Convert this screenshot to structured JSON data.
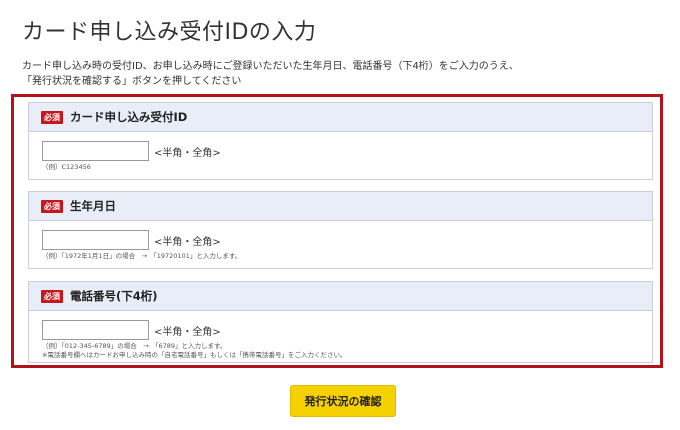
{
  "page": {
    "title": "カード申し込み受付IDの入力",
    "intro_line1": "カード申し込み時の受付ID、お申し込み時にご登録いただいた生年月日、電話番号（下4桁）をご入力のうえ、",
    "intro_line2": "「発行状況を確認する」ボタンを押してください"
  },
  "form": {
    "required_badge": "必須",
    "fields": [
      {
        "label": "カード申し込み受付ID",
        "value": "",
        "hint": "<半角・全角>",
        "notes": [
          "（例）C123456"
        ]
      },
      {
        "label": "生年月日",
        "value": "",
        "hint": "<半角・全角>",
        "notes": [
          "（例）「1972年1月1日」の場合　→　「19720101」と入力します。"
        ]
      },
      {
        "label": "電話番号(下4桁)",
        "value": "",
        "hint": "<半角・全角>",
        "notes": [
          "（例）「012-345-6789」の場合　→　「6789」と入力します。",
          "※電話番号欄へはカードお申し込み時の「自宅電話番号」もしくは「携帯電話番号」をご入力ください。"
        ]
      }
    ]
  },
  "confirm_button_label": "発行状況の確認",
  "colors": {
    "frame_border": "#b3121a",
    "required_badge": "#c8161e",
    "field_header": "#e8edf7",
    "button": "#f6d100"
  }
}
